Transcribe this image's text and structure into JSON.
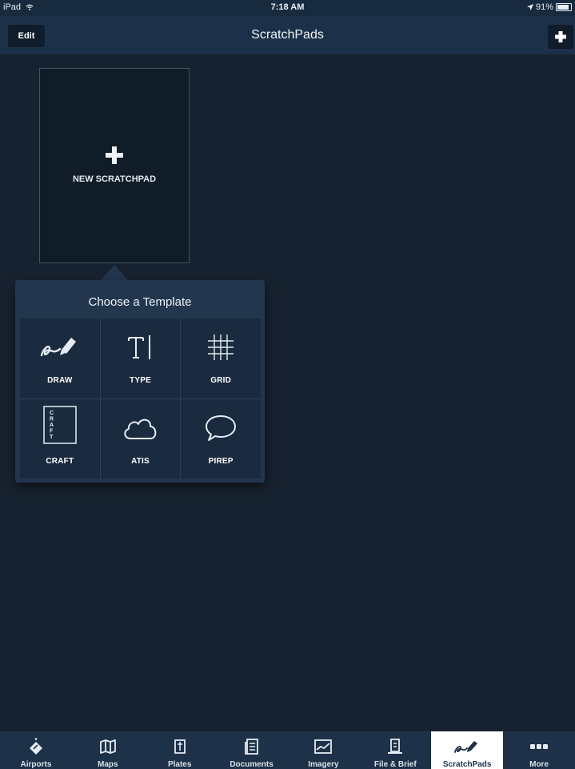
{
  "status_bar": {
    "device": "iPad",
    "time": "7:18 AM",
    "battery": "91%",
    "battery_level": 0.91
  },
  "nav": {
    "title": "ScratchPads",
    "edit_label": "Edit"
  },
  "new_scratchpad": {
    "label": "NEW SCRATCHPAD"
  },
  "popover": {
    "title": "Choose a Template",
    "templates": [
      {
        "label": "DRAW",
        "icon": "draw-icon"
      },
      {
        "label": "TYPE",
        "icon": "type-icon"
      },
      {
        "label": "GRID",
        "icon": "grid-icon"
      },
      {
        "label": "CRAFT",
        "icon": "craft-icon",
        "icon_text": "CRAFT"
      },
      {
        "label": "ATIS",
        "icon": "cloud-icon"
      },
      {
        "label": "PIREP",
        "icon": "speech-bubble-icon"
      }
    ]
  },
  "tab_bar": {
    "tabs": [
      {
        "label": "Airports",
        "icon": "airport-icon"
      },
      {
        "label": "Maps",
        "icon": "map-icon"
      },
      {
        "label": "Plates",
        "icon": "plates-icon"
      },
      {
        "label": "Documents",
        "icon": "documents-icon"
      },
      {
        "label": "Imagery",
        "icon": "imagery-icon"
      },
      {
        "label": "File & Brief",
        "icon": "file-brief-icon"
      },
      {
        "label": "ScratchPads",
        "icon": "scratchpad-icon",
        "active": true
      },
      {
        "label": "More",
        "icon": "more-icon"
      }
    ]
  },
  "colors": {
    "background": "#172230",
    "nav_bar": "#1c3149",
    "popover": "#22364e",
    "active_tab": "#ffffff"
  }
}
